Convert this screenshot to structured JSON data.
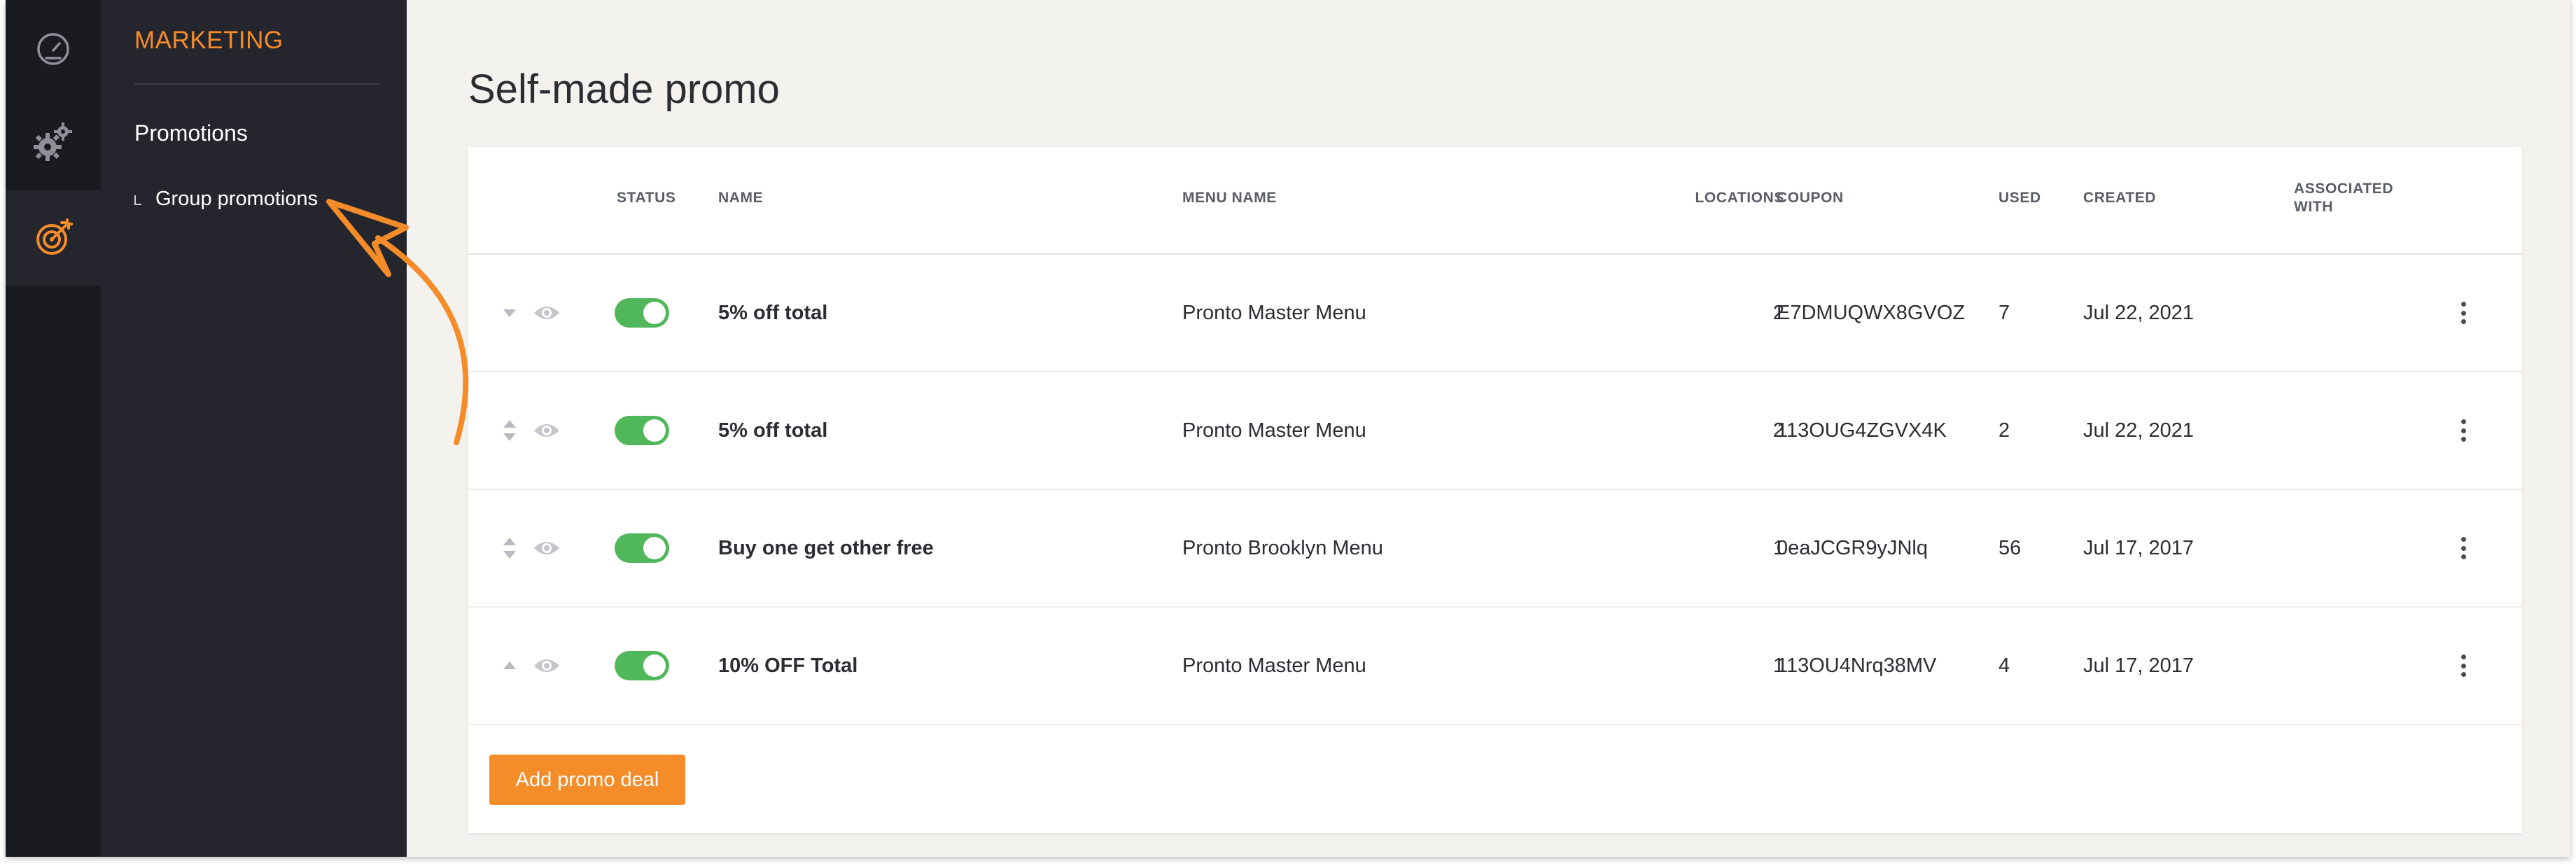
{
  "nav": {
    "rail_icons": [
      "dashboard-icon",
      "gears-icon",
      "target-icon"
    ],
    "active_index": 2,
    "accent_color": "#f58c2a"
  },
  "submenu": {
    "title": "MARKETING",
    "item": "Promotions",
    "subitem": "Group promotions"
  },
  "page": {
    "title": "Self-made promo"
  },
  "table": {
    "headers": {
      "status": "STATUS",
      "name": "NAME",
      "menu_name": "MENU NAME",
      "locations": "LOCATIONS",
      "coupon": "COUPON",
      "used": "USED",
      "created": "CREATED",
      "associated_line1": "ASSOCIATED",
      "associated_line2": "WITH"
    },
    "rows": [
      {
        "sort": "down",
        "status_on": true,
        "name": "5% off total",
        "menu_name": "Pronto Master Menu",
        "locations": "2",
        "coupon": "E7DMUQWX8GVOZ",
        "used": "7",
        "created": "Jul 22, 2021"
      },
      {
        "sort": "both",
        "status_on": true,
        "name": "5% off total",
        "menu_name": "Pronto Master Menu",
        "locations": "2",
        "coupon": "113OUG4ZGVX4K",
        "used": "2",
        "created": "Jul 22, 2021"
      },
      {
        "sort": "both",
        "status_on": true,
        "name": "Buy one get other free",
        "menu_name": "Pronto Brooklyn Menu",
        "locations": "1",
        "coupon": "0eaJCGR9yJNlq",
        "used": "56",
        "created": "Jul 17, 2017"
      },
      {
        "sort": "up",
        "status_on": true,
        "name": "10% OFF Total",
        "menu_name": "Pronto Master Menu",
        "locations": "1",
        "coupon": "113OU4Nrq38MV",
        "used": "4",
        "created": "Jul 17, 2017"
      }
    ]
  },
  "actions": {
    "add_label": "Add promo deal"
  },
  "colors": {
    "toggle_on": "#50b85a",
    "sidebar_dark": "#1a1b20",
    "submenu_bg": "#25262d",
    "main_bg": "#f3f2ef"
  }
}
